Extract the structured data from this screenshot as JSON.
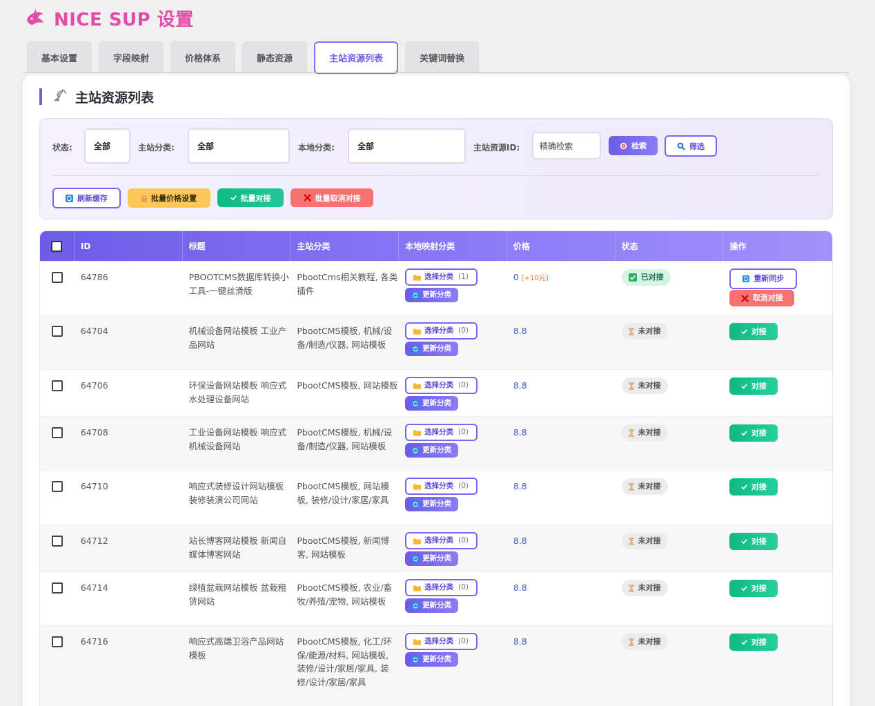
{
  "app": {
    "title": "NICE SUP 设置"
  },
  "tabs": [
    {
      "label": "基本设置",
      "active": false
    },
    {
      "label": "字段映射",
      "active": false
    },
    {
      "label": "价格体系",
      "active": false
    },
    {
      "label": "静态资源",
      "active": false
    },
    {
      "label": "主站资源列表",
      "active": true
    },
    {
      "label": "关键词替换",
      "active": false
    }
  ],
  "section": {
    "title": "主站资源列表"
  },
  "filters": {
    "status_label": "状态:",
    "status_value": "全部",
    "main_category_label": "主站分类:",
    "main_category_value": "全部",
    "local_category_label": "本地分类:",
    "local_category_value": "全部",
    "resource_id_label": "主站资源ID:",
    "resource_id_placeholder": "精确检索",
    "search_label": "检索",
    "filter_label": "筛选"
  },
  "actions": {
    "refresh_cache": "刷新缓存",
    "batch_price": "批量价格设置",
    "batch_connect": "批量对接",
    "batch_cancel": "批量取消对接"
  },
  "table": {
    "headers": [
      "ID",
      "标题",
      "主站分类",
      "本地映射分类",
      "价格",
      "状态",
      "操作"
    ],
    "select_category_label": "选择分类",
    "update_category_label": "更新分类",
    "resync_label": "重新同步",
    "cancel_label": "取消对接",
    "connect_label": "对接",
    "rows": [
      {
        "id": "64786",
        "title": "PBOOTCMS数据库转换小工具-一键丝滑版",
        "main_category": "PbootCms相关教程, 各类插件",
        "count": "(1)",
        "price": "0",
        "price_extra": "[+10元]",
        "status": "已对接",
        "connected": true,
        "height": 78
      },
      {
        "id": "64704",
        "title": "机械设备网站模板 工业产品网站",
        "main_category": "PbootCMS模板, 机械/设备/制造/仪器, 网站模板",
        "count": "(0)",
        "price": "8.8",
        "price_extra": "",
        "status": "未对接",
        "connected": false,
        "height": 79
      },
      {
        "id": "64706",
        "title": "环保设备网站模板 响应式水处理设备网站",
        "main_category": "PbootCMS模板, 网站模板",
        "count": "(0)",
        "price": "8.8",
        "price_extra": "",
        "status": "未对接",
        "connected": false,
        "height": 68
      },
      {
        "id": "64708",
        "title": "工业设备网站模板 响应式机械设备网站",
        "main_category": "PbootCMS模板, 机械/设备/制造/仪器, 网站模板",
        "count": "(0)",
        "price": "8.8",
        "price_extra": "",
        "status": "未对接",
        "connected": false,
        "height": 78
      },
      {
        "id": "64710",
        "title": "响应式装修设计网站模板 装修装潢公司网站",
        "main_category": "PbootCMS模板, 网站模板, 装修/设计/家居/家具",
        "count": "(0)",
        "price": "8.8",
        "price_extra": "",
        "status": "未对接",
        "connected": false,
        "height": 79
      },
      {
        "id": "64712",
        "title": "站长博客网站模板 新闻自媒体博客网站",
        "main_category": "PbootCMS模板, 新闻博客, 网站模板",
        "count": "(0)",
        "price": "8.8",
        "price_extra": "",
        "status": "未对接",
        "connected": false,
        "height": 68
      },
      {
        "id": "64714",
        "title": "绿植盆栽网站模板 盆栽租赁网站",
        "main_category": "PbootCMS模板, 农业/畜牧/养殖/宠物, 网站模板",
        "count": "(0)",
        "price": "8.8",
        "price_extra": "",
        "status": "未对接",
        "connected": false,
        "height": 78
      },
      {
        "id": "64716",
        "title": "响应式高端卫浴产品网站模板",
        "main_category": "PbootCMS模板, 化工/环保/能源/材料, 网站模板, 装修/设计/家居/家具, 装修/设计/家居/家具",
        "count": "(0)",
        "price": "8.8",
        "price_extra": "",
        "status": "未对接",
        "connected": false,
        "height": 120
      }
    ]
  }
}
